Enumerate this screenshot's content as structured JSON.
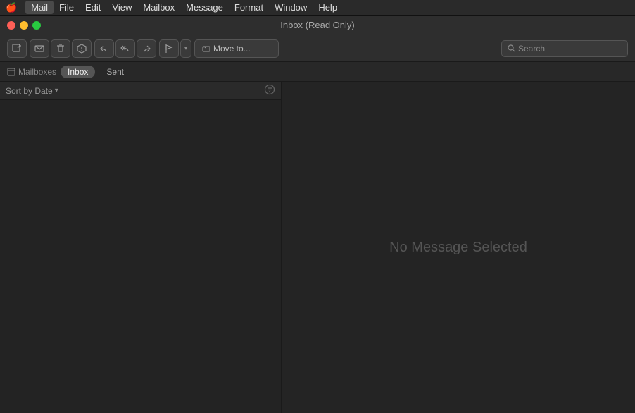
{
  "menubar": {
    "apple": "🍎",
    "items": [
      {
        "label": "Mail",
        "active": true
      },
      {
        "label": "File",
        "active": false
      },
      {
        "label": "Edit",
        "active": false
      },
      {
        "label": "View",
        "active": false
      },
      {
        "label": "Mailbox",
        "active": false
      },
      {
        "label": "Message",
        "active": false
      },
      {
        "label": "Format",
        "active": false
      },
      {
        "label": "Window",
        "active": false
      },
      {
        "label": "Help",
        "active": false
      }
    ]
  },
  "titlebar": {
    "title": "Inbox (Read Only)"
  },
  "toolbar": {
    "compose_icon": "✏",
    "delete_icon": "🗑",
    "trash_icon": "🗑",
    "reply_icon": "↩",
    "reply_all_icon": "↩↩",
    "forward_icon": "↪",
    "flag_icon": "⚑",
    "move_to_label": "Move to...",
    "search_placeholder": "Search"
  },
  "nav": {
    "mailboxes_label": "Mailboxes",
    "tabs": [
      {
        "label": "Inbox",
        "active": true
      },
      {
        "label": "Sent",
        "active": false
      }
    ]
  },
  "left_panel": {
    "sort_label": "Sort by Date",
    "sort_arrow": "▾"
  },
  "right_panel": {
    "no_message_text": "No Message Selected"
  }
}
